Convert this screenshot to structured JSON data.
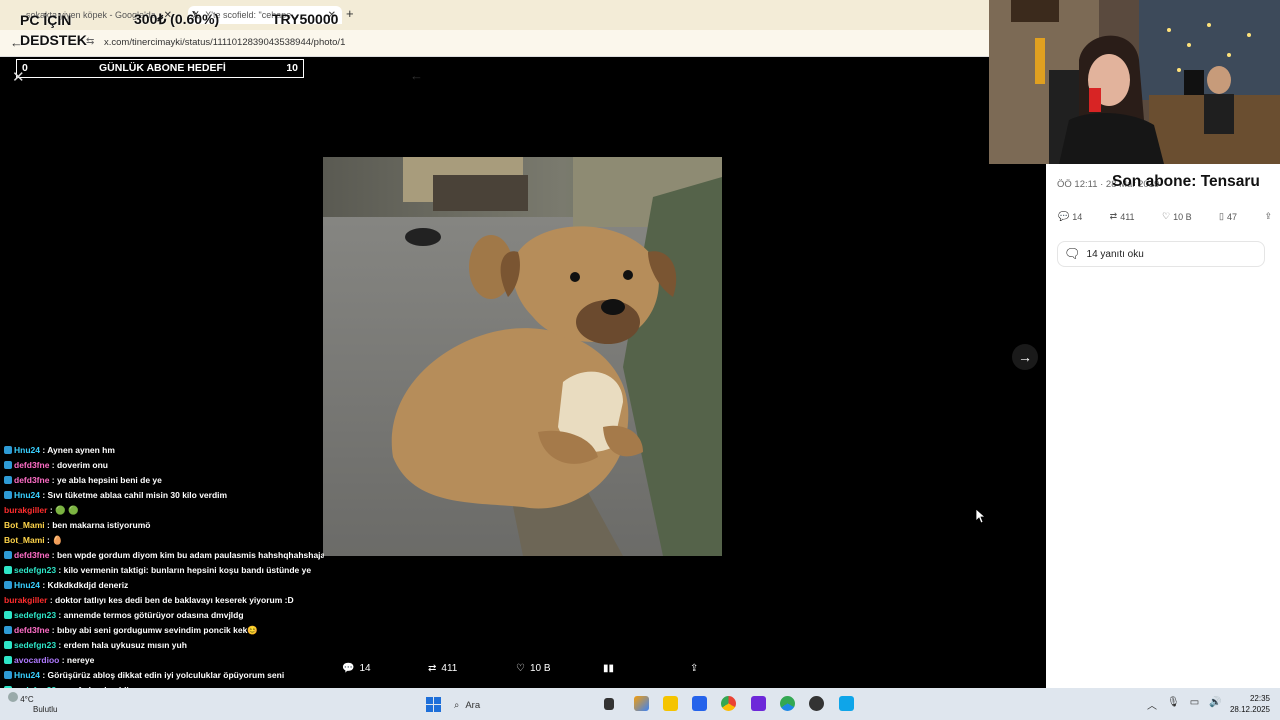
{
  "browser": {
    "tabs": [
      {
        "label": "sokakta yiyen köpek - Google'da"
      },
      {
        "label": "X'te scofield: \"cehape..."
      }
    ],
    "url": "x.com/tinercimayki/status/1111012839043538944/photo/1"
  },
  "stream": {
    "pc_support_line1": "PC İÇİN",
    "pc_support_line2": "DEDSTEK",
    "donation_1": "300₺ (0.60%)",
    "donation_2": "TRY50000",
    "goal": {
      "min": "0",
      "title": "GÜNLÜK ABONE HEDEFİ",
      "max": "10"
    },
    "last_subscriber": "Son abone: Tensaru"
  },
  "viewer": {
    "bottom_actions": [
      {
        "icon": "reply-icon",
        "count": "14"
      },
      {
        "icon": "retweet-icon",
        "count": "411"
      },
      {
        "icon": "heart-icon",
        "count": "10 B"
      },
      {
        "icon": "stats-icon",
        "count": ""
      },
      {
        "icon": "share-icon",
        "count": ""
      }
    ]
  },
  "side_panel": {
    "timestamp": "ÖÖ 12:11 · 28 Mar 2019",
    "actions": [
      {
        "icon": "reply-icon",
        "count": "14"
      },
      {
        "icon": "retweet-icon",
        "count": "411"
      },
      {
        "icon": "heart-icon",
        "count": "10 B"
      },
      {
        "icon": "bookmark-icon",
        "count": "47"
      },
      {
        "icon": "share-icon",
        "count": ""
      }
    ],
    "read_replies": "14 yanıtı oku"
  },
  "chat": [
    {
      "user": "Hnu24",
      "color": "#3ad0ff",
      "badge": "#2e9bd6",
      "msg": "Aynen aynen hm"
    },
    {
      "user": "defd3fne",
      "color": "#ff6ec7",
      "badge": "#2e9bd6",
      "msg": "doverim onu"
    },
    {
      "user": "defd3fne",
      "color": "#ff6ec7",
      "badge": "#2e9bd6",
      "msg": "ye abla hepsini beni de ye"
    },
    {
      "user": "Hnu24",
      "color": "#3ad0ff",
      "badge": "#2e9bd6",
      "msg": "Sıvı tüketme ablaa cahil misin 30 kilo verdim"
    },
    {
      "user": "burakgiller",
      "color": "#ff2d2d",
      "badge": "",
      "msg": "🟢 🟢"
    },
    {
      "user": "Bot_Mami",
      "color": "#ffd54a",
      "badge": "",
      "msg": "ben makarna istiyorumö"
    },
    {
      "user": "Bot_Mami",
      "color": "#ffd54a",
      "badge": "",
      "msg": "🥚"
    },
    {
      "user": "defd3fne",
      "color": "#ff6ec7",
      "badge": "#2e9bd6",
      "msg": "ben wpde gordum diyom kim bu adam paulasmis hahshqhahshaja"
    },
    {
      "user": "sedefgn23",
      "color": "#2ee6c8",
      "badge": "#2ee6c8",
      "msg": "kilo vermenin taktigi: bunların hepsini koşu bandı üstünde ye"
    },
    {
      "user": "Hnu24",
      "color": "#3ad0ff",
      "badge": "#2e9bd6",
      "msg": "Kdkdkdkdjd deneriz"
    },
    {
      "user": "burakgiller",
      "color": "#ff2d2d",
      "badge": "",
      "msg": "doktor tatlıyı kes dedi ben de baklavayı keserek yiyorum :D"
    },
    {
      "user": "sedefgn23",
      "color": "#2ee6c8",
      "badge": "#2ee6c8",
      "msg": "annemde termos götürüyor odasına dmvjldg"
    },
    {
      "user": "defd3fne",
      "color": "#ff6ec7",
      "badge": "#2e9bd6",
      "msg": "bıbıy abi seni gordugumw sevindim poncik kek😊"
    },
    {
      "user": "sedefgn23",
      "color": "#2ee6c8",
      "badge": "#2ee6c8",
      "msg": "erdem hala uykusuz mısın yuh"
    },
    {
      "user": "avocardioo",
      "color": "#b07aff",
      "badge": "#2ee6c8",
      "msg": "nereye"
    },
    {
      "user": "Hnu24",
      "color": "#3ad0ff",
      "badge": "#2e9bd6",
      "msg": "Görüşürüz abloş dikkat edin iyi yolculuklar öpüyorum seni"
    },
    {
      "user": "sedefgn23",
      "color": "#2ee6c8",
      "badge": "#2ee6c8",
      "msg": "senfmhmdsmblj"
    }
  ],
  "taskbar": {
    "weather_temp": "4°C",
    "weather_desc": "Bulutlu",
    "search_placeholder": "Ara",
    "time": "22:35",
    "date": "28.12.2025"
  }
}
